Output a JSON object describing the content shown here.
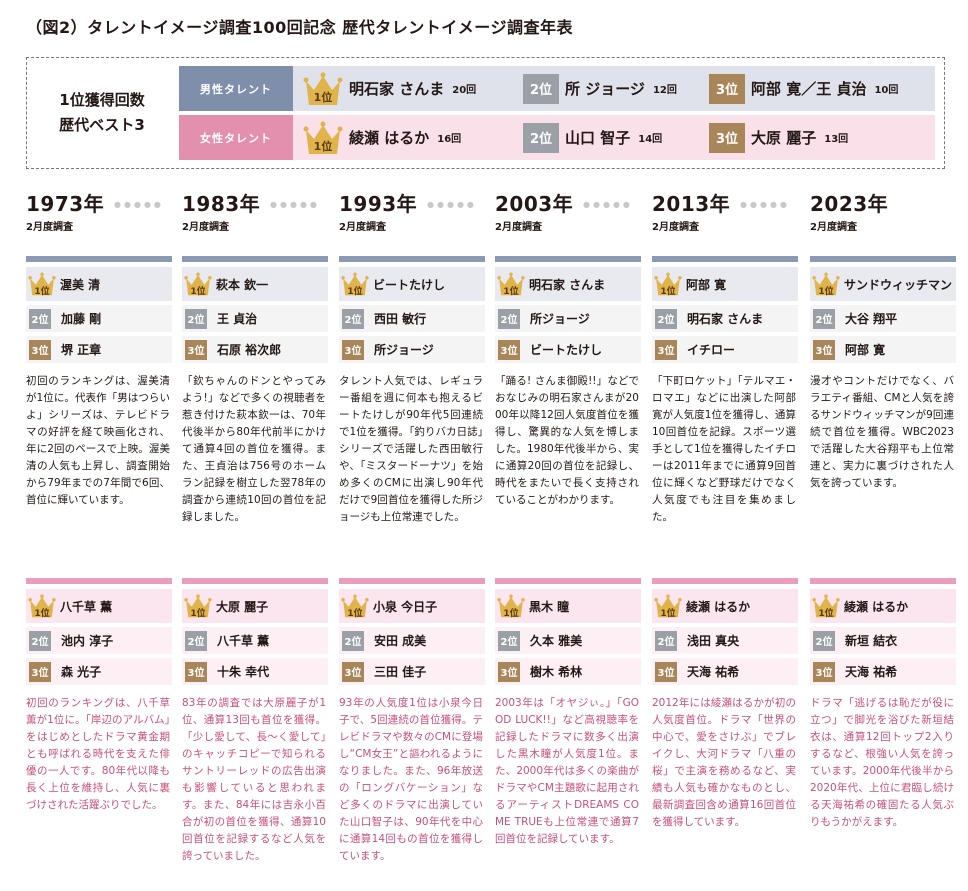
{
  "title": "（図2）タレントイメージ調査100回記念 歴代タレントイメージ調査年表",
  "summary": {
    "label_line1": "1位獲得回数",
    "label_line2": "歴代ベスト3",
    "male": {
      "tag": "男性タレント",
      "entries": [
        {
          "rank": "1位",
          "name": "明石家 さんま",
          "count": "20回"
        },
        {
          "rank": "2位",
          "name": "所 ジョージ",
          "count": "12回"
        },
        {
          "rank": "3位",
          "name": "阿部 寛／王 貞治",
          "count": "10回"
        }
      ]
    },
    "female": {
      "tag": "女性タレント",
      "entries": [
        {
          "rank": "1位",
          "name": "綾瀬 はるか",
          "count": "16回"
        },
        {
          "rank": "2位",
          "name": "山口 智子",
          "count": "14回"
        },
        {
          "rank": "3位",
          "name": "大原 麗子",
          "count": "13回"
        }
      ]
    }
  },
  "timeline_dots": "●●●●●",
  "years": [
    {
      "year": "1973年",
      "sub": "2月度調査",
      "male": {
        "r1": "1位",
        "r2": "2位",
        "r3": "3位",
        "first": "渥美 清",
        "second": "加藤 剛",
        "third": "堺 正章",
        "desc": "初回のランキングは、渥美清が1位に。代表作「男はつらいよ」シリーズは、テレビドラマの好評を経て映画化され、年に2回のペースで上映。渥美清の人気も上昇し、調査開始から79年までの7年間で6回、首位に輝いています。"
      },
      "female": {
        "r1": "1位",
        "r2": "2位",
        "r3": "3位",
        "first": "八千草 薫",
        "second": "池内 淳子",
        "third": "森 光子",
        "desc": "初回のランキングは、八千草薫が1位に。「岸辺のアルバム」をはじめとしたドラマ黄金期とも呼ばれる時代を支えた俳優の一人です。80年代以降も長く上位を維持し、人気に裏づけされた活躍ぶりでした。"
      }
    },
    {
      "year": "1983年",
      "sub": "2月度調査",
      "male": {
        "r1": "1位",
        "r2": "2位",
        "r3": "3位",
        "first": "萩本 欽一",
        "second": "王 貞治",
        "third": "石原 裕次郎",
        "desc": "「欽ちゃんのドンとやってみよう!」などで多くの視聴者を惹き付けた萩本欽一は、70年代後半から80年代前半にかけて通算4回の首位を獲得。また、王貞治は756号のホームラン記録を樹立した翌78年の調査から連続10回の首位を記録しました。"
      },
      "female": {
        "r1": "1位",
        "r2": "2位",
        "r3": "3位",
        "first": "大原 麗子",
        "second": "八千草 薫",
        "third": "十朱 幸代",
        "desc": "83年の調査では大原麗子が1位、通算13回も首位を獲得。「少し愛して、長〜く愛して」のキャッチコピーで知られるサントリーレッドの広告出演も影響していると思われます。また、84年には吉永小百合が初の首位を獲得、通算10回首位を記録するなど人気を誇っていました。"
      }
    },
    {
      "year": "1993年",
      "sub": "2月度調査",
      "male": {
        "r1": "1位",
        "r2": "2位",
        "r3": "3位",
        "first": "ビートたけし",
        "second": "西田 敏行",
        "third": "所ジョージ",
        "desc": "タレント人気では、レギュラー番組を週に何本も抱えるビートたけしが90年代5回連続で1位を獲得。「釣りバカ日誌」シリーズで活躍した西田敏行や、「ミスタードーナツ」を始め多くのCMに出演し90年代だけで9回首位を獲得した所ジョージも上位常連でした。"
      },
      "female": {
        "r1": "1位",
        "r2": "2位",
        "r3": "3位",
        "first": "小泉 今日子",
        "second": "安田 成美",
        "third": "三田 佳子",
        "desc": "93年の人気度1位は小泉今日子で、5回連続の首位獲得。テレビドラマや数々のCMに登場し“CM女王”と謳われるようになりました。また、96年放送の「ロングバケーション」など多くのドラマに出演していた山口智子は、90年代を中心に通算14回もの首位を獲得しています。"
      }
    },
    {
      "year": "2003年",
      "sub": "2月度調査",
      "male": {
        "r1": "1位",
        "r2": "2位",
        "r3": "3位",
        "first": "明石家 さんま",
        "second": "所ジョージ",
        "third": "ビートたけし",
        "desc": "「踊る! さんま御殿!!」などでおなじみの明石家さんまが2000年以降12回人気度首位を獲得し、驚異的な人気を博しました。1980年代後半から、実に通算20回の首位を記録し、時代をまたいで長く支持されていることがわかります。"
      },
      "female": {
        "r1": "1位",
        "r2": "2位",
        "r3": "3位",
        "first": "黒木 瞳",
        "second": "久本 雅美",
        "third": "樹木 希林",
        "desc": "2003年は「オヤジぃ。」「GOOD LUCK!!」など高視聴率を記録したドラマに数多く出演した黒木瞳が人気度1位。また、2000年代は多くの楽曲がドラマやCM主題歌に起用されるアーティストDREAMS COME TRUEも上位常連で通算7回首位を記録しています。"
      }
    },
    {
      "year": "2013年",
      "sub": "2月度調査",
      "male": {
        "r1": "1位",
        "r2": "2位",
        "r3": "3位",
        "first": "阿部 寛",
        "second": "明石家 さんま",
        "third": "イチロー",
        "desc": "「下町ロケット」「テルマエ・ロマエ」などに出演した阿部寛が人気度1位を獲得し、通算10回首位を記録。スポーツ選手として1位を獲得したイチローは2011年までに通算9回首位に輝くなど野球だけでなく人気度でも注目を集めました。"
      },
      "female": {
        "r1": "1位",
        "r2": "2位",
        "r3": "3位",
        "first": "綾瀬 はるか",
        "second": "浅田 真央",
        "third": "天海 祐希",
        "desc": "2012年には綾瀬はるかが初の人気度首位。ドラマ「世界の中心で、愛をさけぶ」でブレイクし、大河ドラマ「八重の桜」で主演を務めるなど、実績も人気も確かなものとし、最新調査回含め通算16回首位を獲得しています。"
      }
    },
    {
      "year": "2023年",
      "sub": "2月度調査",
      "male": {
        "r1": "1位",
        "r2": "2位",
        "r3": "3位",
        "first": "サンドウィッチマン",
        "second": "大谷 翔平",
        "third": "阿部 寛",
        "desc": "漫才やコントだけでなく、バラエティ番組、CMと人気を誇るサンドウィッチマンが9回連続で首位を獲得。WBC2023で活躍した大谷翔平も上位常連と、実力に裏づけされた人気を誇っています。"
      },
      "female": {
        "r1": "1位",
        "r2": "2位",
        "r3": "3位",
        "first": "綾瀬 はるか",
        "second": "新垣 結衣",
        "third": "天海 祐希",
        "desc": "ドラマ「逃げるは恥だが役に立つ」で脚光を浴びた新垣結衣は、通算12回トップ2入りするなど、根強い人気を誇っています。2000年代後半から2020年代、上位に君臨し続ける天海祐希の確固たる人気ぶりもうかがえます。"
      }
    }
  ]
}
